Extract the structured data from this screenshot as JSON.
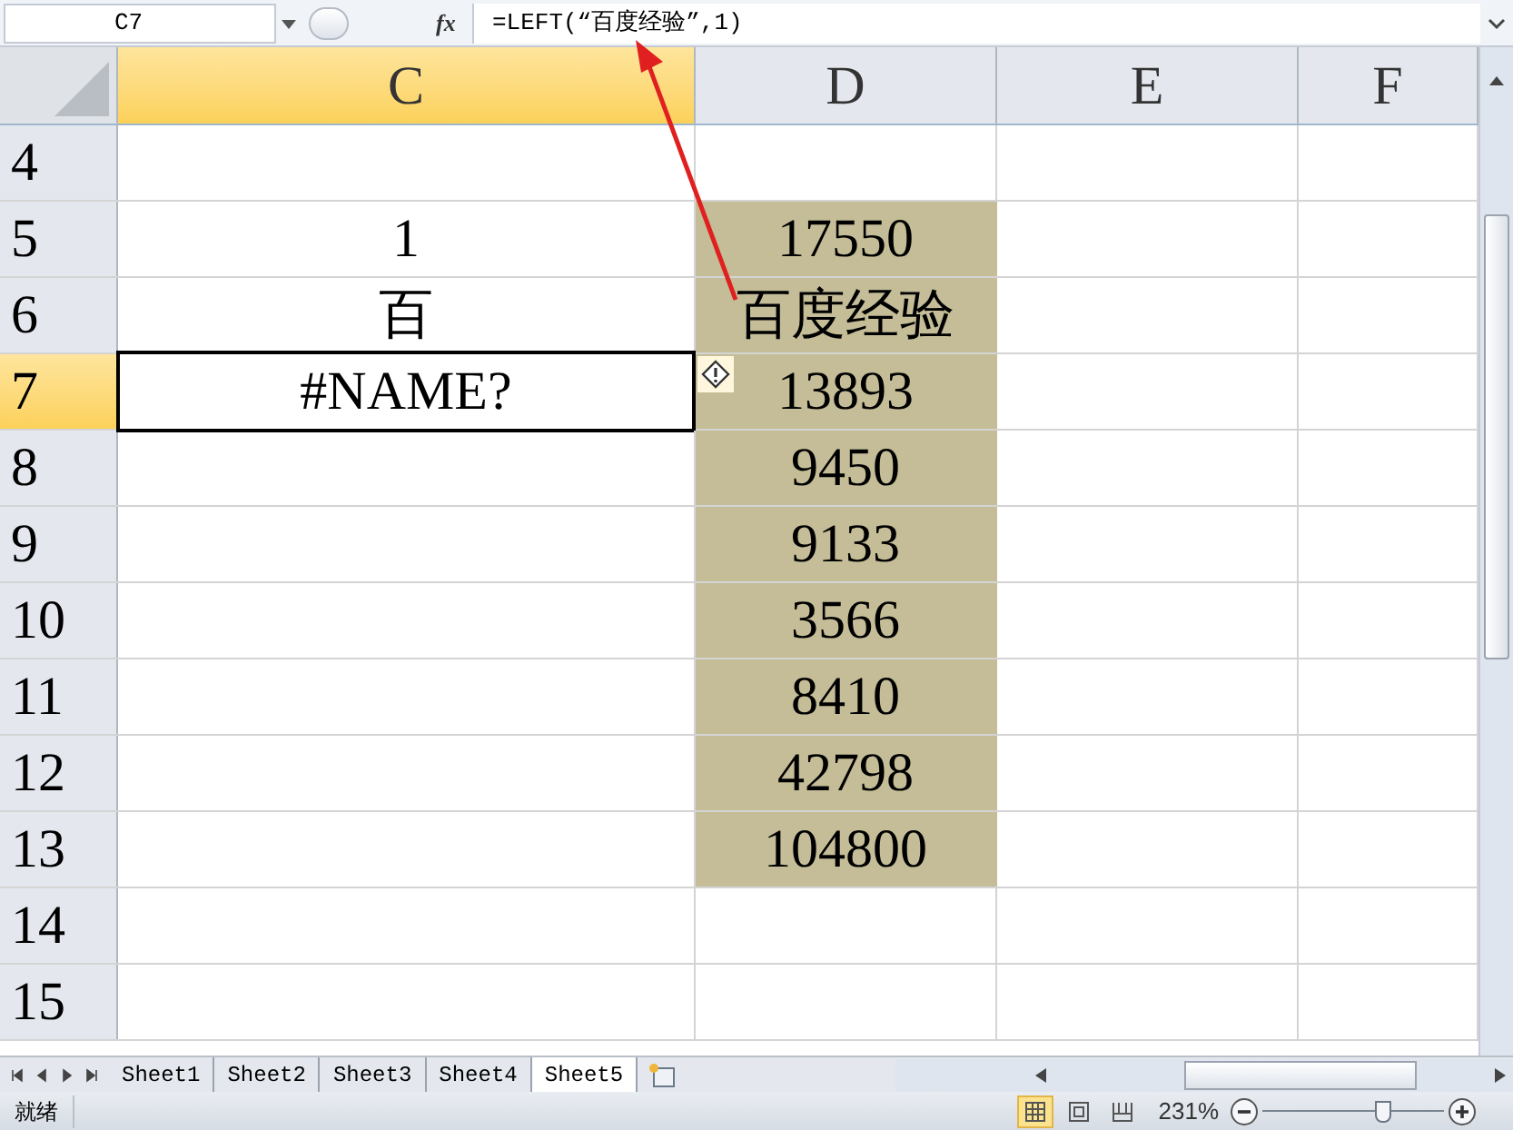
{
  "formula_bar": {
    "name_box": "C7",
    "function_label": "fx",
    "formula": "=LEFT(“百度经验”,1)"
  },
  "columns": [
    {
      "label": "C",
      "selected": true
    },
    {
      "label": "D",
      "selected": false
    },
    {
      "label": "E",
      "selected": false
    },
    {
      "label": "F",
      "selected": false
    }
  ],
  "rows": [
    {
      "label": "4",
      "selected": false
    },
    {
      "label": "5",
      "selected": false,
      "c": "1",
      "d": "17550",
      "d_filled": true
    },
    {
      "label": "6",
      "selected": false,
      "c": "百",
      "d": "百度经验",
      "d_filled": true
    },
    {
      "label": "7",
      "selected": true,
      "c": "#NAME?",
      "d": "13893",
      "d_filled": true,
      "error_indicator": true
    },
    {
      "label": "8",
      "selected": false,
      "d": "9450",
      "d_filled": true
    },
    {
      "label": "9",
      "selected": false,
      "d": "9133",
      "d_filled": true
    },
    {
      "label": "10",
      "selected": false,
      "d": "3566",
      "d_filled": true
    },
    {
      "label": "11",
      "selected": false,
      "d": "8410",
      "d_filled": true
    },
    {
      "label": "12",
      "selected": false,
      "d": "42798",
      "d_filled": true
    },
    {
      "label": "13",
      "selected": false,
      "d": "104800",
      "d_filled": true
    },
    {
      "label": "14",
      "selected": false
    },
    {
      "label": "15",
      "selected": false
    }
  ],
  "sheet_tabs": [
    {
      "label": "Sheet1",
      "selected": false
    },
    {
      "label": "Sheet2",
      "selected": false
    },
    {
      "label": "Sheet3",
      "selected": false
    },
    {
      "label": "Sheet4",
      "selected": false
    },
    {
      "label": "Sheet5",
      "selected": true
    }
  ],
  "status_bar": {
    "status": "就绪",
    "views": [
      {
        "kind": "normal",
        "selected": true
      },
      {
        "kind": "layout",
        "selected": false
      },
      {
        "kind": "pagebreak",
        "selected": false
      }
    ],
    "zoom": "231%",
    "zoom_slider": {
      "level": 0.66
    }
  }
}
